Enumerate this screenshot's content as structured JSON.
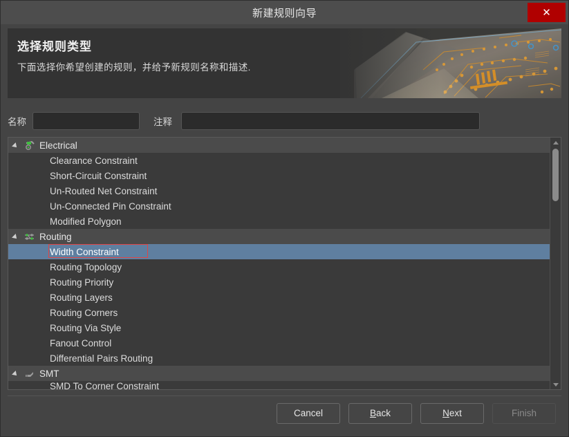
{
  "window": {
    "title": "新建规则向导",
    "close_icon": "close-icon",
    "close_glyph": "✕"
  },
  "banner": {
    "heading": "选择规则类型",
    "subtitle": "下面选择你希望创建的规则，并给予新规则名称和描述.",
    "image_alt": "pcb-board-photo"
  },
  "form": {
    "name_label": "名称",
    "name_value": "",
    "name_placeholder": "",
    "comment_label": "注释",
    "comment_value": "",
    "comment_placeholder": ""
  },
  "tree": {
    "selected_item": "Width Constraint",
    "highlight_color": "#e04545",
    "selection_color": "#5f7fa0",
    "groups": [
      {
        "label": "Electrical",
        "icon": "electrical-net-icon",
        "expanded": true,
        "items": [
          "Clearance Constraint",
          "Short-Circuit Constraint",
          "Un-Routed Net Constraint",
          "Un-Connected Pin Constraint",
          "Modified Polygon"
        ]
      },
      {
        "label": "Routing",
        "icon": "routing-track-icon",
        "expanded": true,
        "items": [
          "Width Constraint",
          "Routing Topology",
          "Routing Priority",
          "Routing Layers",
          "Routing Corners",
          "Routing Via Style",
          "Fanout Control",
          "Differential Pairs Routing"
        ]
      },
      {
        "label": "SMT",
        "icon": "smt-pad-icon",
        "expanded": true,
        "items": [
          "SMD To Corner Constraint"
        ]
      }
    ]
  },
  "footer": {
    "cancel": "Cancel",
    "back_pre": "",
    "back_mnemonic": "B",
    "back_post": "ack",
    "next_pre": "",
    "next_mnemonic": "N",
    "next_post": "ext",
    "finish": "Finish",
    "finish_enabled": false
  }
}
